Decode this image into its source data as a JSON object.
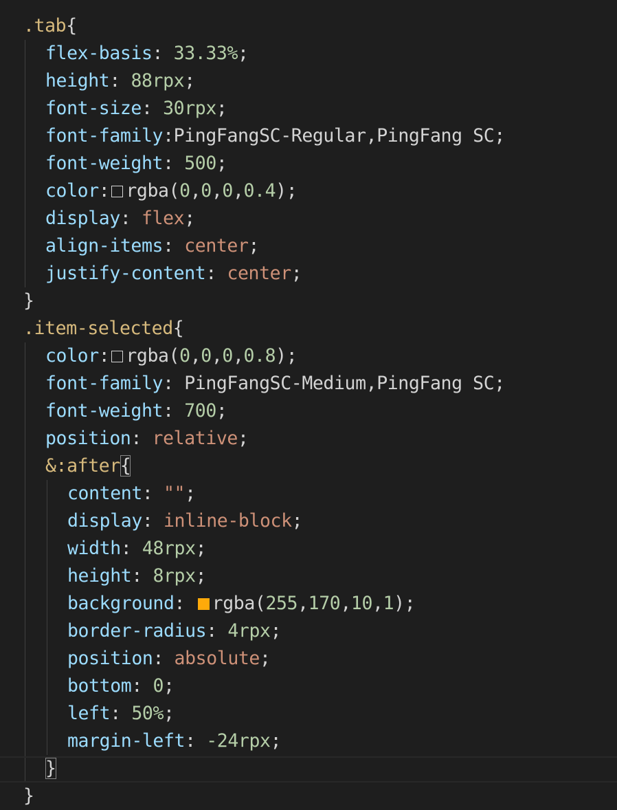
{
  "theme": {
    "background": "#1e1e1e",
    "selector_color": "#d7ba7d",
    "property_color": "#9cdcfe",
    "number_color": "#b5cea8",
    "value_keyword_color": "#ce9178",
    "punctuation_color": "#d4d4d4"
  },
  "code": {
    "block1": {
      "selector": ".tab",
      "lines": [
        {
          "prop": "flex-basis",
          "sep": ": ",
          "num": "33.33",
          "unit": "%",
          "end": ";"
        },
        {
          "prop": "height",
          "sep": ": ",
          "num": "88",
          "unit": "rpx",
          "end": ";"
        },
        {
          "prop": "font-size",
          "sep": ": ",
          "num": "30",
          "unit": "rpx",
          "end": ";"
        },
        {
          "prop": "font-family",
          "sep": ":",
          "text": "PingFangSC-Regular,PingFang SC",
          "end": ";"
        },
        {
          "prop": "font-weight",
          "sep": ": ",
          "num": "500",
          "end": ";"
        },
        {
          "prop": "color",
          "sep": ":",
          "fn": "rgba(",
          "n1": "0",
          "n2": "0",
          "n3": "0",
          "n4": "0.4",
          "close": ")",
          "end": ";",
          "swatch_color": "rgba(0,0,0,0.4)"
        },
        {
          "prop": "display",
          "sep": ": ",
          "kw": "flex",
          "end": ";"
        },
        {
          "prop": "align-items",
          "sep": ": ",
          "kw": "center",
          "end": ";"
        },
        {
          "prop": "justify-content",
          "sep": ": ",
          "kw": "center",
          "end": ";"
        }
      ],
      "close": "}"
    },
    "block2": {
      "selector": ".item-selected",
      "lines": [
        {
          "prop": "color",
          "sep": ":",
          "fn": "rgba(",
          "n1": "0",
          "n2": "0",
          "n3": "0",
          "n4": "0.8",
          "close": ")",
          "end": ";",
          "swatch_color": "rgba(0,0,0,0.8)"
        },
        {
          "prop": "font-family",
          "sep": ": ",
          "text": "PingFangSC-Medium,PingFang SC",
          "end": ";"
        },
        {
          "prop": "font-weight",
          "sep": ": ",
          "num": "700",
          "end": ";"
        },
        {
          "prop": "position",
          "sep": ": ",
          "kw": "relative",
          "end": ";"
        }
      ],
      "nested_selector": "&:after",
      "nested_lines": [
        {
          "prop": "content",
          "sep": ": ",
          "str": "\"\"",
          "end": ";"
        },
        {
          "prop": "display",
          "sep": ": ",
          "kw": "inline-block",
          "end": ";"
        },
        {
          "prop": "width",
          "sep": ": ",
          "num": "48",
          "unit": "rpx",
          "end": ";"
        },
        {
          "prop": "height",
          "sep": ": ",
          "num": "8",
          "unit": "rpx",
          "end": ";"
        },
        {
          "prop": "background",
          "sep": ": ",
          "fn": "rgba(",
          "n1": "255",
          "n2": "170",
          "n3": "10",
          "n4": "1",
          "close": ")",
          "end": ";",
          "swatch_color": "#ffaa0a"
        },
        {
          "prop": "border-radius",
          "sep": ": ",
          "num": "4",
          "unit": "rpx",
          "end": ";"
        },
        {
          "prop": "position",
          "sep": ": ",
          "kw": "absolute",
          "end": ";"
        },
        {
          "prop": "bottom",
          "sep": ": ",
          "num": "0",
          "end": ";"
        },
        {
          "prop": "left",
          "sep": ": ",
          "num": "50",
          "unit": "%",
          "end": ";"
        },
        {
          "prop": "margin-left",
          "sep": ": ",
          "num": "-24",
          "unit": "rpx",
          "end": ";"
        }
      ],
      "nested_close": "}",
      "close": "}"
    },
    "open_brace": "{",
    "comma": ","
  }
}
